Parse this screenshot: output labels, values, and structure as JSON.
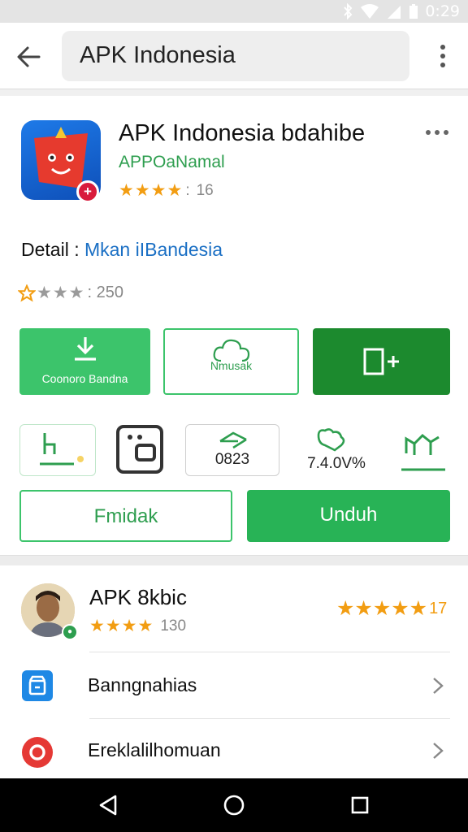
{
  "status_bar": {
    "time": "0:29"
  },
  "toolbar": {
    "search_value": "APK Indonesia"
  },
  "app": {
    "title": "APK Indonesia bdahibe",
    "developer": "APPOaNamal",
    "stars": "★★★★",
    "stars_suffix": ":",
    "rating_count": "16",
    "badge": "+"
  },
  "detail": {
    "label": "Detail :",
    "value": "Mkan iIBandesia",
    "stars": "★★★",
    "rating_count": ": 250"
  },
  "action_buttons": {
    "download_label": "Coonoro Bandna",
    "outline_label": "Nmusak"
  },
  "stats": {
    "count_value": "0823",
    "percent_value": "7.4.0V%"
  },
  "buttons": {
    "secondary_label": "Fmidak",
    "primary_label": "Unduh"
  },
  "review": {
    "title": "APK 8kbic",
    "stars": "★★★★",
    "rating_count": "130",
    "big_stars": "★★★★★",
    "big_count": "17"
  },
  "list_items": [
    {
      "label": "Banngnahias"
    },
    {
      "label": "Ereklalilhomuan"
    }
  ],
  "colors": {
    "accent_green": "#3cc46b",
    "dark_green": "#1c8a2e",
    "link_blue": "#1a6fc4",
    "star_orange": "#f29d12"
  },
  "icons": [
    "back-arrow-icon",
    "more-vert-icon",
    "download-icon",
    "cloud-icon",
    "add-box-icon",
    "share-icon",
    "gallery-icon",
    "send-icon",
    "puzzle-icon",
    "chart-icon",
    "store-icon",
    "record-icon",
    "chevron-right-icon",
    "nav-back-icon",
    "nav-home-icon",
    "nav-recents-icon"
  ]
}
